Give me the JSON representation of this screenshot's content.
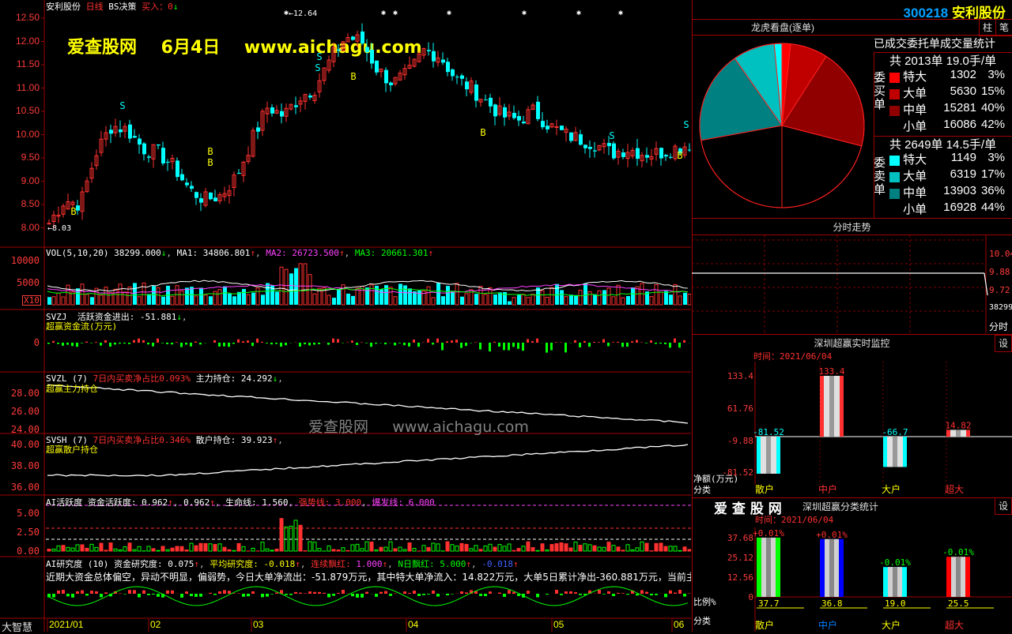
{
  "header": {
    "stock_name": "安利股份",
    "period": "日线",
    "indicator": "BS决策",
    "buy_label": "买入：",
    "buy_value": "0",
    "arrow_down": "↓"
  },
  "overlay": {
    "site": "爱查股网",
    "date": "6月4日",
    "url": "www.aichagu.com"
  },
  "watermark": {
    "site": "爱查股网",
    "url": "www.aichagu.com"
  },
  "price_panel": {
    "yticks": [
      "12.50",
      "12.00",
      "11.50",
      "11.00",
      "10.50",
      "10.00",
      "9.50",
      "9.00",
      "8.50",
      "8.00"
    ],
    "high_label": "←12.64",
    "low_label": "←8.03",
    "signals": [
      {
        "t": "B"
      },
      {
        "t": "S"
      },
      {
        "t": "B"
      },
      {
        "t": "S"
      },
      {
        "t": "B"
      },
      {
        "t": "B"
      },
      {
        "t": "S"
      },
      {
        "t": "S"
      },
      {
        "t": "B"
      },
      {
        "t": "S"
      },
      {
        "t": "B"
      }
    ]
  },
  "vol_panel": {
    "name": "VOL(5,10,20)",
    "value": "38299.000",
    "ma1_label": "MA1:",
    "ma1": "34806.801",
    "ma2_label": "MA2:",
    "ma2": "26723.500",
    "ma3_label": "MA3:",
    "ma3": "20661.301",
    "yticks": [
      "10000",
      "5000"
    ],
    "unit": "X10"
  },
  "svzj_panel": {
    "name": "SVZJ",
    "label": "活跃资金进出:",
    "value": "-51.881",
    "subtitle": "超赢资金流(万元)",
    "ytick": "0"
  },
  "svzl_panel": {
    "name": "SVZL (7)",
    "label1": "7日内买卖净占比",
    "value1": "0.093%",
    "label2": "主力持仓:",
    "value2": "24.292",
    "subtitle": "超赢主力持仓",
    "yticks": [
      "28.00",
      "26.00",
      "24.00"
    ]
  },
  "svsh_panel": {
    "name": "SVSH (7)",
    "label1": "7日内买卖净占比",
    "value1": "0.346%",
    "label2": "散户持仓:",
    "value2": "39.923",
    "subtitle": "超赢散户持仓",
    "yticks": [
      "40.00",
      "38.00",
      "36.00"
    ]
  },
  "ai_panel": {
    "name": "AI活跃度",
    "l1": "资金活跃度:",
    "v1": "0.962",
    "v1b": "0.962",
    "l2": "生命线:",
    "v2": "1.560",
    "l3": "强势线:",
    "v3": "3.000",
    "l4": "爆发线:",
    "v4": "6.000",
    "yticks": [
      "5.00",
      "2.50",
      "0.00"
    ]
  },
  "ai_research": {
    "name": "AI研究度 (10)",
    "l1": "资金研究度:",
    "v1": "0.075",
    "l2": "平均研究度:",
    "v2": "-0.018",
    "l3": "连续飘红:",
    "v3": "1.000",
    "l4": "N日飘红:",
    "v4": "5.000",
    "v5": "-0.018",
    "summary": "近期大资金总体偏空，异动不明显，偏弱势，今日大单净流出：-51.879万元，其中特大单净流入：14.822万元，大单5日累计净出-360.881万元，当前主力资"
  },
  "xaxis": {
    "labels": [
      "2021/01",
      "02",
      "03",
      "04",
      "05",
      "06"
    ],
    "footer_left": "大智慧"
  },
  "right": {
    "code": "300218",
    "name": "安利股份",
    "btn1": "柱",
    "btn2": "笔",
    "pie_title": "龙虎看盘(逐单)",
    "stats_title": "已成交委托单成交量统计",
    "buy": {
      "side": "委买单",
      "total": "共 2013单 19.0手/单",
      "rows": [
        {
          "label": "特大",
          "value": "1302",
          "pct": "3%",
          "color": "#ff0000"
        },
        {
          "label": "大单",
          "value": "5630",
          "pct": "15%",
          "color": "#c00000"
        },
        {
          "label": "中单",
          "value": "15281",
          "pct": "40%",
          "color": "#900000"
        },
        {
          "label": "小单",
          "value": "16086",
          "pct": "42%",
          "color": "#000000"
        }
      ]
    },
    "sell": {
      "side": "委卖单",
      "total": "共 2649单 14.5手/单",
      "rows": [
        {
          "label": "特大",
          "value": "1149",
          "pct": "3%",
          "color": "#00ffff"
        },
        {
          "label": "大单",
          "value": "6319",
          "pct": "17%",
          "color": "#00c0c0"
        },
        {
          "label": "中单",
          "value": "13903",
          "pct": "36%",
          "color": "#008080"
        },
        {
          "label": "小单",
          "value": "16928",
          "pct": "44%",
          "color": "#000000"
        }
      ]
    },
    "timeshare": {
      "title": "分时走势",
      "yticks": [
        "10.04",
        "9.88",
        "9.72"
      ],
      "vol": "38299",
      "foot": "分时"
    },
    "monitor": {
      "title": "深圳超赢实时监控",
      "btn": "设",
      "time_label": "时间：",
      "time": "2021/06/04",
      "yticks": [
        "133.4",
        "61.76",
        "-9.88",
        "-81.52"
      ],
      "ylabel": "净额(万元)",
      "cat_label": "分类",
      "bars": [
        {
          "cat": "散户",
          "value": "-81.52",
          "v": -81.52
        },
        {
          "cat": "中户",
          "value": "133.4",
          "v": 133.4
        },
        {
          "cat": "大户",
          "value": "-66.7",
          "v": -66.7
        },
        {
          "cat": "超大",
          "value": "14.82",
          "v": 14.82
        }
      ]
    },
    "classify": {
      "brand": "爱 查 股 网",
      "title": "深圳超赢分类统计",
      "btn": "设",
      "time_label": "时间：",
      "time": "2021/06/04",
      "yticks": [
        "37.68",
        "25.12",
        "12.56",
        "0"
      ],
      "ylabel": "比例%",
      "cat_label": "分类",
      "bars": [
        {
          "cat": "散户",
          "pct": "+0.01%",
          "value": "37.7",
          "v": 37.7
        },
        {
          "cat": "中户",
          "pct": "+0.01%",
          "value": "36.8",
          "v": 36.8
        },
        {
          "cat": "大户",
          "pct": "-0.01%",
          "value": "19.0",
          "v": 19.0
        },
        {
          "cat": "超大",
          "pct": "-0.01%",
          "value": "25.5",
          "v": 25.5
        }
      ]
    }
  }
}
